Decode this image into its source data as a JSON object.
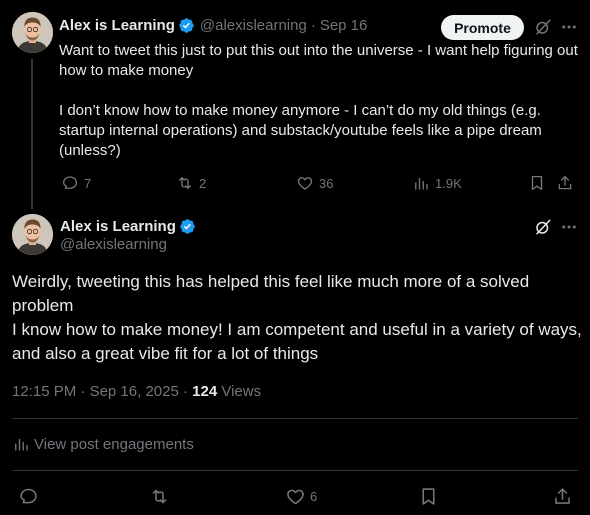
{
  "parent_tweet": {
    "author_name": "Alex is Learning",
    "handle": "@alexislearning",
    "separator": "·",
    "date": "Sep 16",
    "promote_label": "Promote",
    "paragraph_1": "Want to tweet this just to put this out into the universe - I want help figuring out how to make money",
    "paragraph_2": "I don’t know how to make money anymore - I can’t do my old things (e.g. startup internal operations) and substack/youtube feels like a pipe dream (unless?)",
    "replies": "7",
    "reposts": "2",
    "likes": "36",
    "views": "1.9K"
  },
  "main_tweet": {
    "author_name": "Alex is Learning",
    "handle": "@alexislearning",
    "line_1": "Weirdly, tweeting this has helped this feel like much more of a solved problem",
    "line_2": "I know how to make money! I am competent and useful in a variety of ways, and also a great vibe fit for a lot of things",
    "time": "12:15 PM",
    "date": "Sep 16, 2025",
    "separator": "·",
    "views_count": "124",
    "views_label": "Views",
    "engagements_label": "View post engagements",
    "likes": "6"
  },
  "icons": {
    "verified": "verified-badge-icon",
    "grok": "grok-icon",
    "more": "more-icon",
    "reply": "reply-icon",
    "repost": "repost-icon",
    "like": "heart-icon",
    "views": "analytics-icon",
    "bookmark": "bookmark-icon",
    "share": "share-icon"
  },
  "colors": {
    "background": "#000000",
    "text": "#e7e9ea",
    "muted": "#71767b",
    "verified": "#1d9bf0",
    "divider": "#2f3336"
  }
}
